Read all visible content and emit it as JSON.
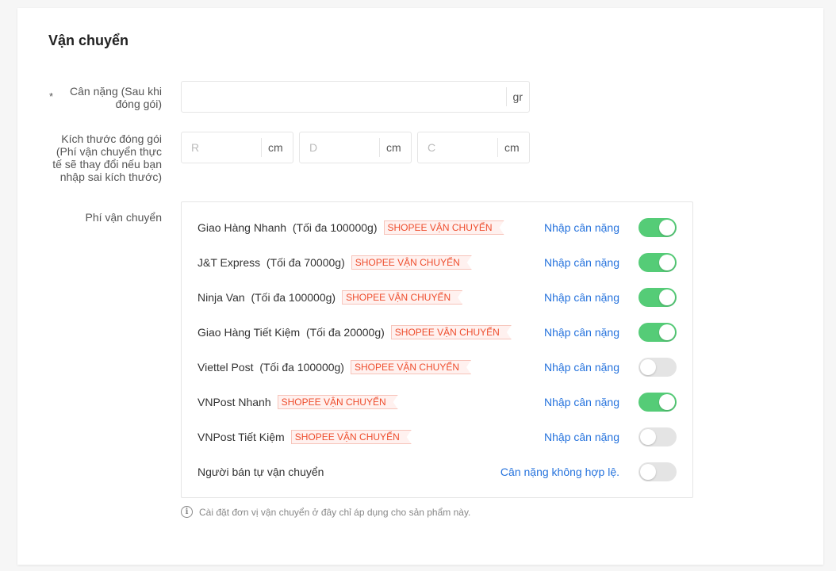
{
  "section": {
    "title": "Vận chuyển"
  },
  "weight": {
    "required_mark": "*",
    "label": "Cân nặng (Sau khi đóng gói)",
    "value": "",
    "placeholder": "",
    "unit": "gr"
  },
  "package_size": {
    "label": "Kích thước đóng gói (Phí vận chuyển thực tế sẽ thay đổi nếu bạn nhập sai kích thước)",
    "fields": [
      {
        "placeholder": "R",
        "unit": "cm"
      },
      {
        "placeholder": "D",
        "unit": "cm"
      },
      {
        "placeholder": "C",
        "unit": "cm"
      }
    ]
  },
  "shipping_fee": {
    "label": "Phí vận chuyển",
    "carriers": [
      {
        "name": "Giao Hàng Nhanh",
        "limit": "(Tối đa 100000g)",
        "badge": "SHOPEE VẬN CHUYỂN",
        "action": "Nhập cân nặng",
        "enabled": true
      },
      {
        "name": "J&T Express",
        "limit": "(Tối đa 70000g)",
        "badge": "SHOPEE VẬN CHUYỂN",
        "action": "Nhập cân nặng",
        "enabled": true
      },
      {
        "name": "Ninja Van",
        "limit": "(Tối đa 100000g)",
        "badge": "SHOPEE VẬN CHUYỂN",
        "action": "Nhập cân nặng",
        "enabled": true
      },
      {
        "name": "Giao Hàng Tiết Kiệm",
        "limit": "(Tối đa 20000g)",
        "badge": "SHOPEE VẬN CHUYỂN",
        "action": "Nhập cân nặng",
        "enabled": true
      },
      {
        "name": "Viettel Post",
        "limit": "(Tối đa 100000g)",
        "badge": "SHOPEE VẬN CHUYỂN",
        "action": "Nhập cân nặng",
        "enabled": false
      },
      {
        "name": "VNPost Nhanh",
        "limit": "",
        "badge": "SHOPEE VẬN CHUYỂN",
        "action": "Nhập cân nặng",
        "enabled": true
      },
      {
        "name": "VNPost Tiết Kiệm",
        "limit": "",
        "badge": "SHOPEE VẬN CHUYỂN",
        "action": "Nhập cân nặng",
        "enabled": false
      },
      {
        "name": "Người bán tự vận chuyển",
        "limit": "",
        "badge": "",
        "action": "Cân nặng không hợp lệ.",
        "enabled": false
      }
    ]
  },
  "hint": {
    "icon": "info-icon",
    "text": "Cài đặt đơn vị vận chuyển ở đây chỉ áp dụng cho sản phẩm này."
  },
  "colors": {
    "toggle_on": "#55cc77",
    "toggle_off": "#e4e4e4",
    "link": "#2673dd",
    "badge_text": "#ee4d2d",
    "badge_bg": "#fff1ef"
  }
}
